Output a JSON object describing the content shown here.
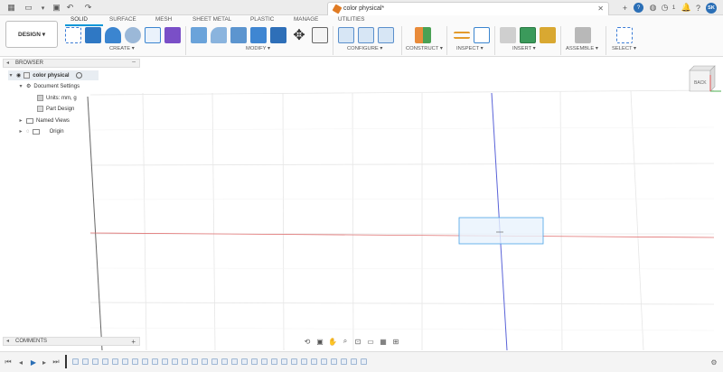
{
  "app_bar": {
    "document_title": "color physical*",
    "job_count": "1",
    "user_initials": "SK",
    "icons": [
      "grid-icon",
      "file-icon",
      "save-icon",
      "undo-icon",
      "redo-icon",
      "close-icon",
      "new-tab-icon",
      "help-icon",
      "clock-icon",
      "bell-icon",
      "question-icon"
    ]
  },
  "ribbon": {
    "workspace_label": "DESIGN ▾",
    "tabs": [
      {
        "label": "SOLID",
        "active": true
      },
      {
        "label": "SURFACE",
        "active": false
      },
      {
        "label": "MESH",
        "active": false
      },
      {
        "label": "SHEET METAL",
        "active": false
      },
      {
        "label": "PLASTIC",
        "active": false
      },
      {
        "label": "MANAGE",
        "active": false
      },
      {
        "label": "UTILITIES",
        "active": false
      }
    ],
    "groups": {
      "create": "CREATE ▾",
      "modify": "MODIFY ▾",
      "configure": "CONFIGURE ▾",
      "construct": "CONSTRUCT ▾",
      "inspect": "INSPECT ▾",
      "insert": "INSERT ▾",
      "assemble": "ASSEMBLE ▾",
      "select": "SELECT ▾"
    }
  },
  "browser": {
    "title": "BROWSER",
    "items": [
      {
        "label": "color physical",
        "name": "root"
      },
      {
        "label": "Document Settings",
        "name": "document-settings"
      },
      {
        "label": "Units: mm, g",
        "name": "units"
      },
      {
        "label": "Part Design",
        "name": "part-design"
      },
      {
        "label": "Named Views",
        "name": "named-views"
      },
      {
        "label": "Origin",
        "name": "origin"
      }
    ]
  },
  "viewcube": {
    "face_label": "BACK"
  },
  "comments": {
    "title": "COMMENTS",
    "add": "+"
  },
  "colors": {
    "accent": "#0696d7",
    "axis_red": "#e07070",
    "axis_blue": "#5a63d8",
    "sketch_blue": "#4aa3e6",
    "grid": "#e4e4e4"
  }
}
